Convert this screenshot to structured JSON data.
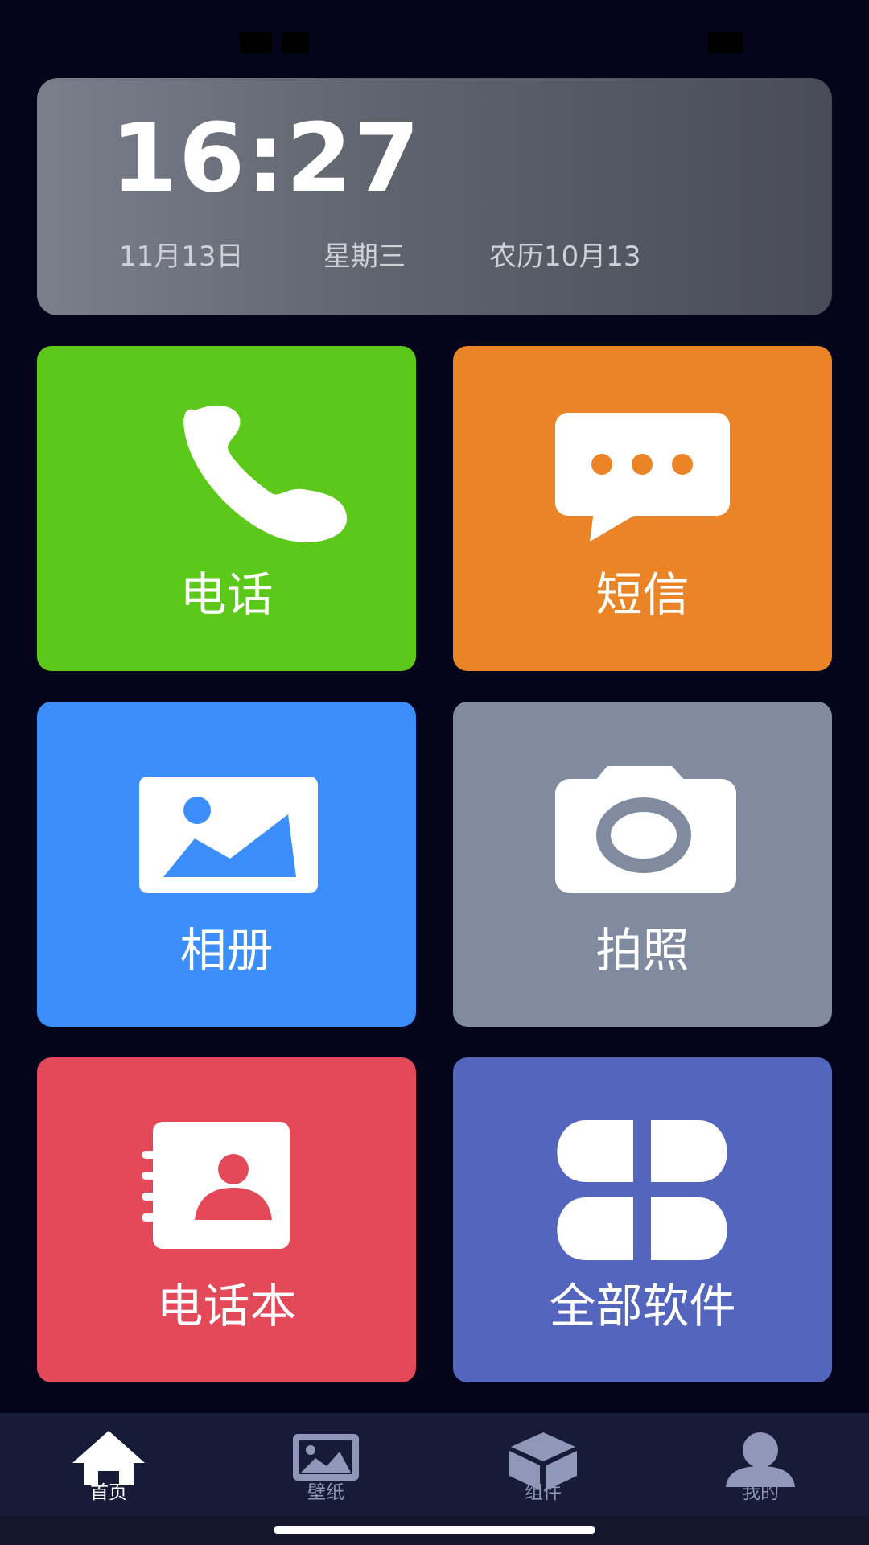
{
  "clock": {
    "time": "16:27",
    "date": "11月13日",
    "weekday": "星期三",
    "lunar": "农历10月13"
  },
  "tiles": [
    {
      "label": "电话",
      "icon": "phone-icon",
      "color": "#5bc81a"
    },
    {
      "label": "短信",
      "icon": "message-icon",
      "color": "#ea8426"
    },
    {
      "label": "相册",
      "icon": "photo-icon",
      "color": "#3c8ffa"
    },
    {
      "label": "拍照",
      "icon": "camera-icon",
      "color": "#808b9f"
    },
    {
      "label": "电话本",
      "icon": "contacts-icon",
      "color": "#e4495a"
    },
    {
      "label": "全部软件",
      "icon": "apps-icon",
      "color": "#5465bd"
    }
  ],
  "nav": {
    "items": [
      {
        "label": "首页",
        "icon": "home-icon",
        "active": true
      },
      {
        "label": "壁纸",
        "icon": "wallpaper-icon",
        "active": false
      },
      {
        "label": "组件",
        "icon": "widget-icon",
        "active": false
      },
      {
        "label": "我的",
        "icon": "profile-icon",
        "active": false
      }
    ],
    "active_color": "#ffffff",
    "inactive_color": "#8f98b8"
  }
}
